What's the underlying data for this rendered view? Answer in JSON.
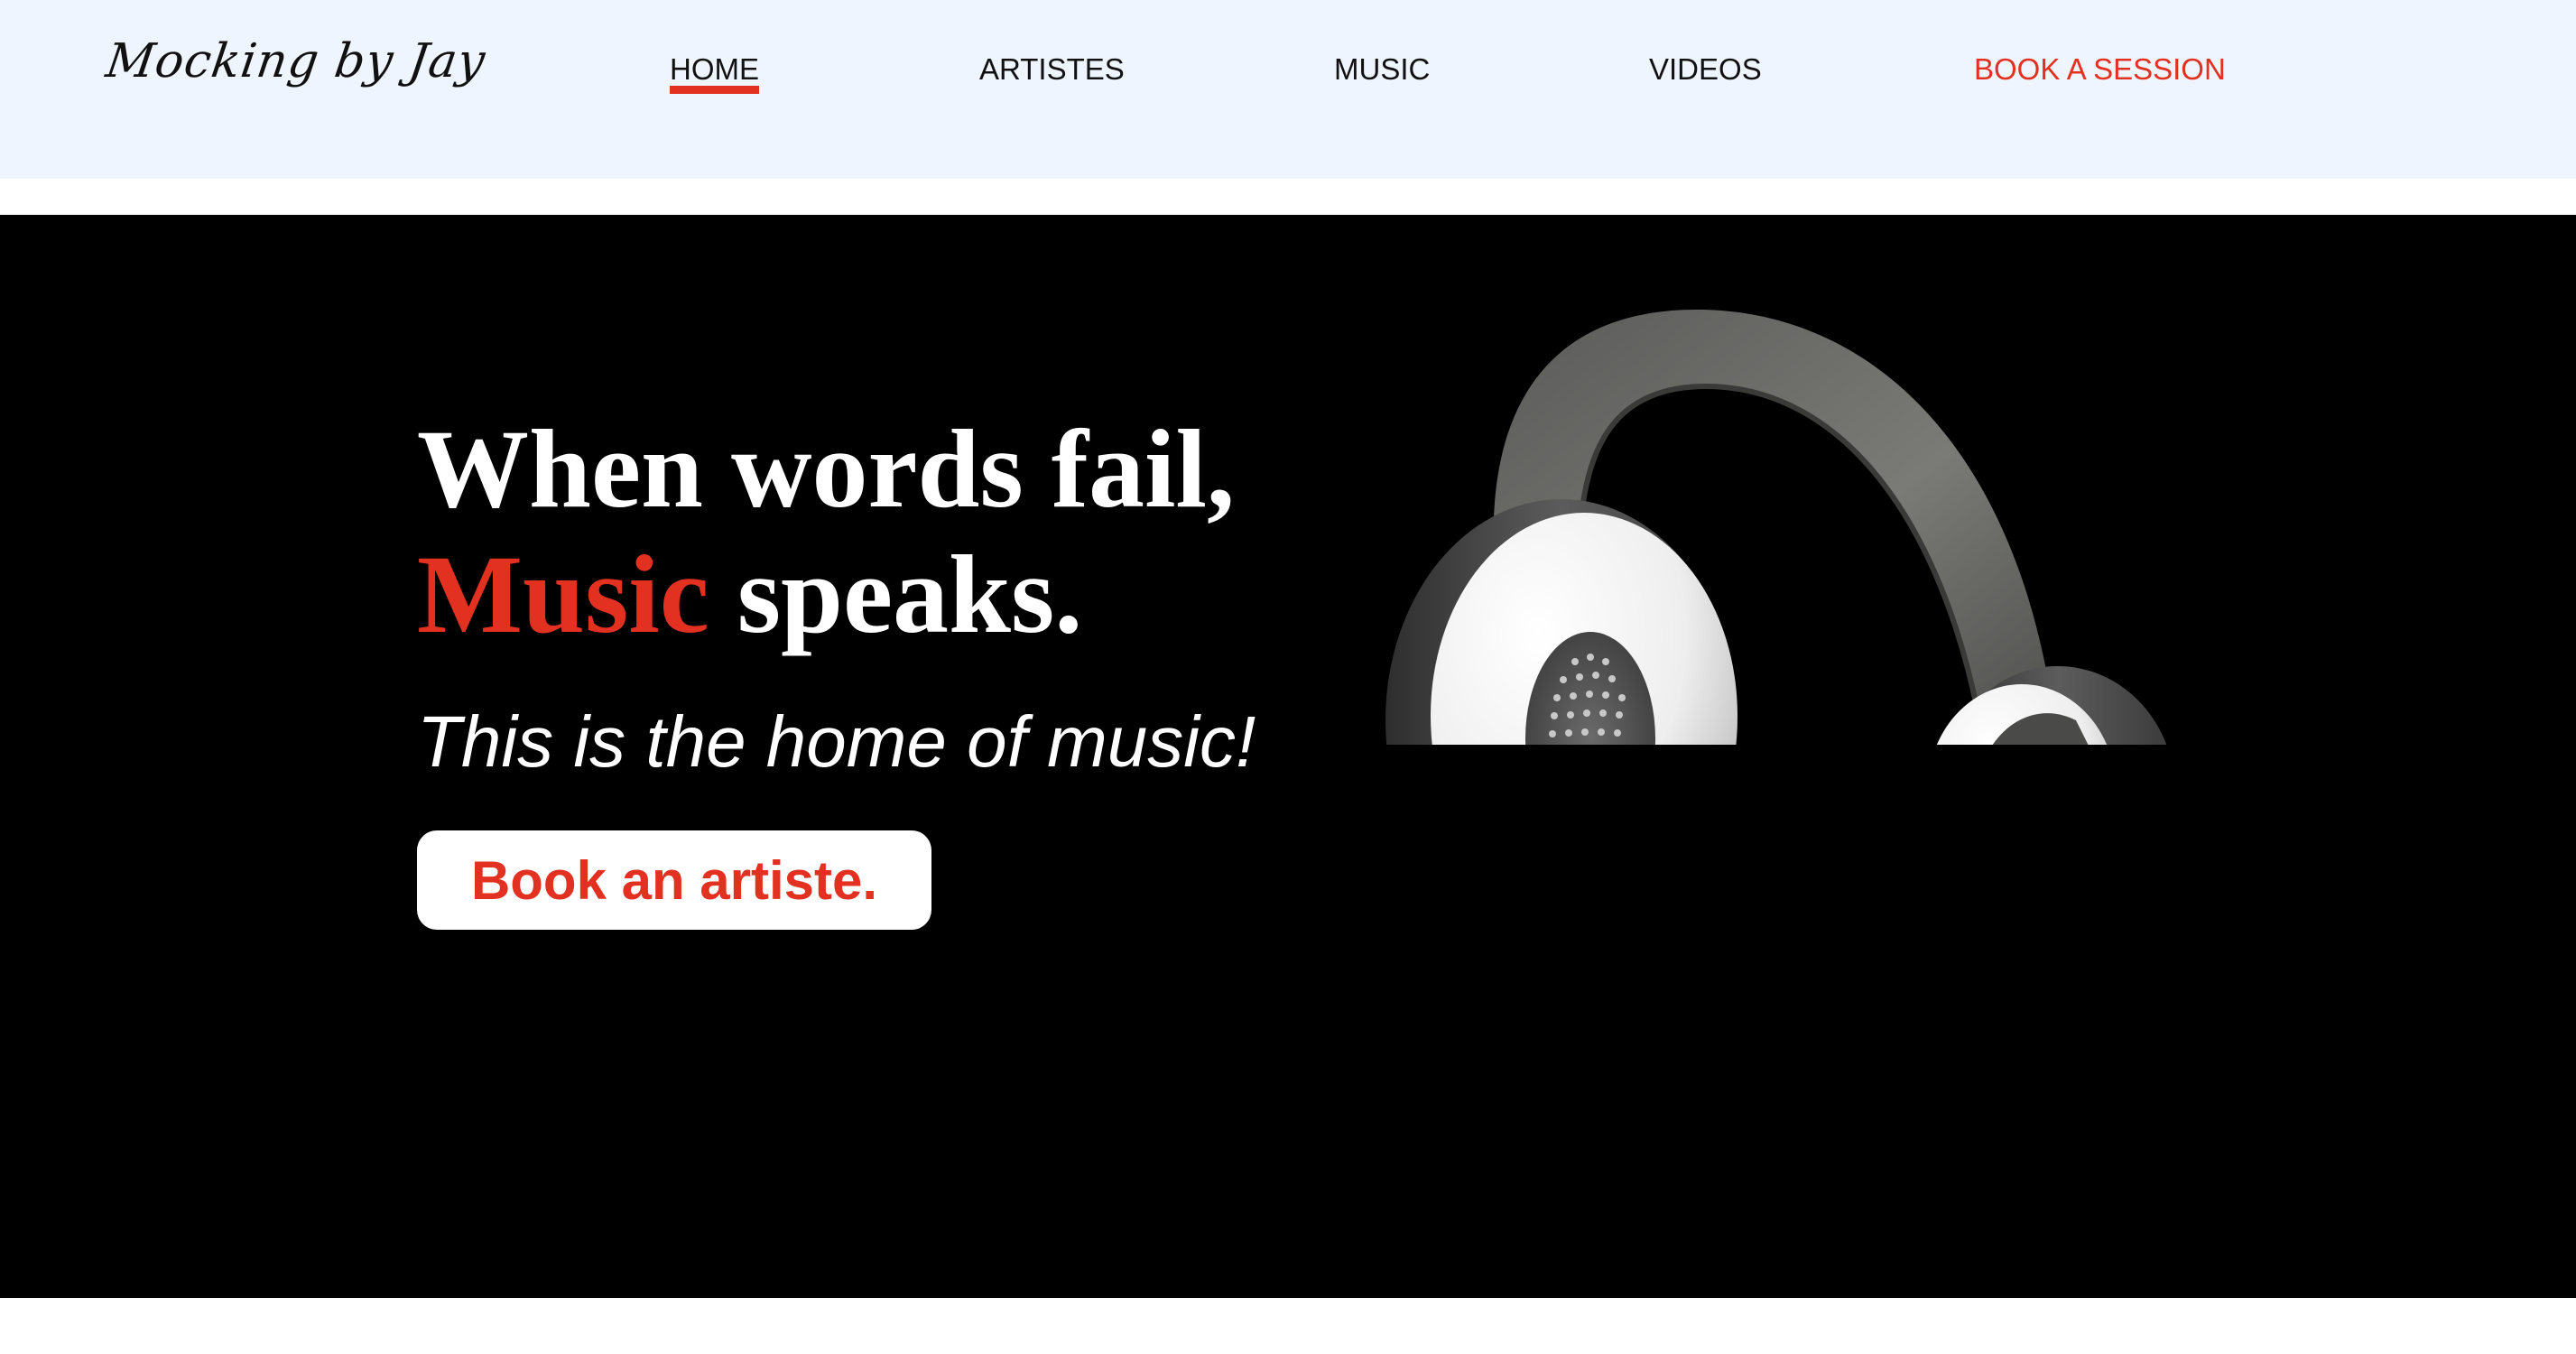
{
  "brand": {
    "logo_text": "Mocking by Jay"
  },
  "nav": {
    "items": [
      {
        "label": "HOME",
        "active": true
      },
      {
        "label": "ARTISTES",
        "active": false
      },
      {
        "label": "MUSIC",
        "active": false
      },
      {
        "label": "VIDEOS",
        "active": false
      }
    ],
    "cta_label": "BOOK A SESSION"
  },
  "hero": {
    "headline_line1": "When words fail,",
    "headline_accent": "Music",
    "headline_line2_rest": " speaks.",
    "tagline": "This is the home of music!",
    "button_label": "Book an artiste.",
    "image_icon": "headphones-illustration"
  },
  "colors": {
    "accent": "#e23121",
    "header_bg": "#eff5fe",
    "hero_bg": "#000000",
    "text_dark": "#111111",
    "text_light": "#ffffff"
  }
}
